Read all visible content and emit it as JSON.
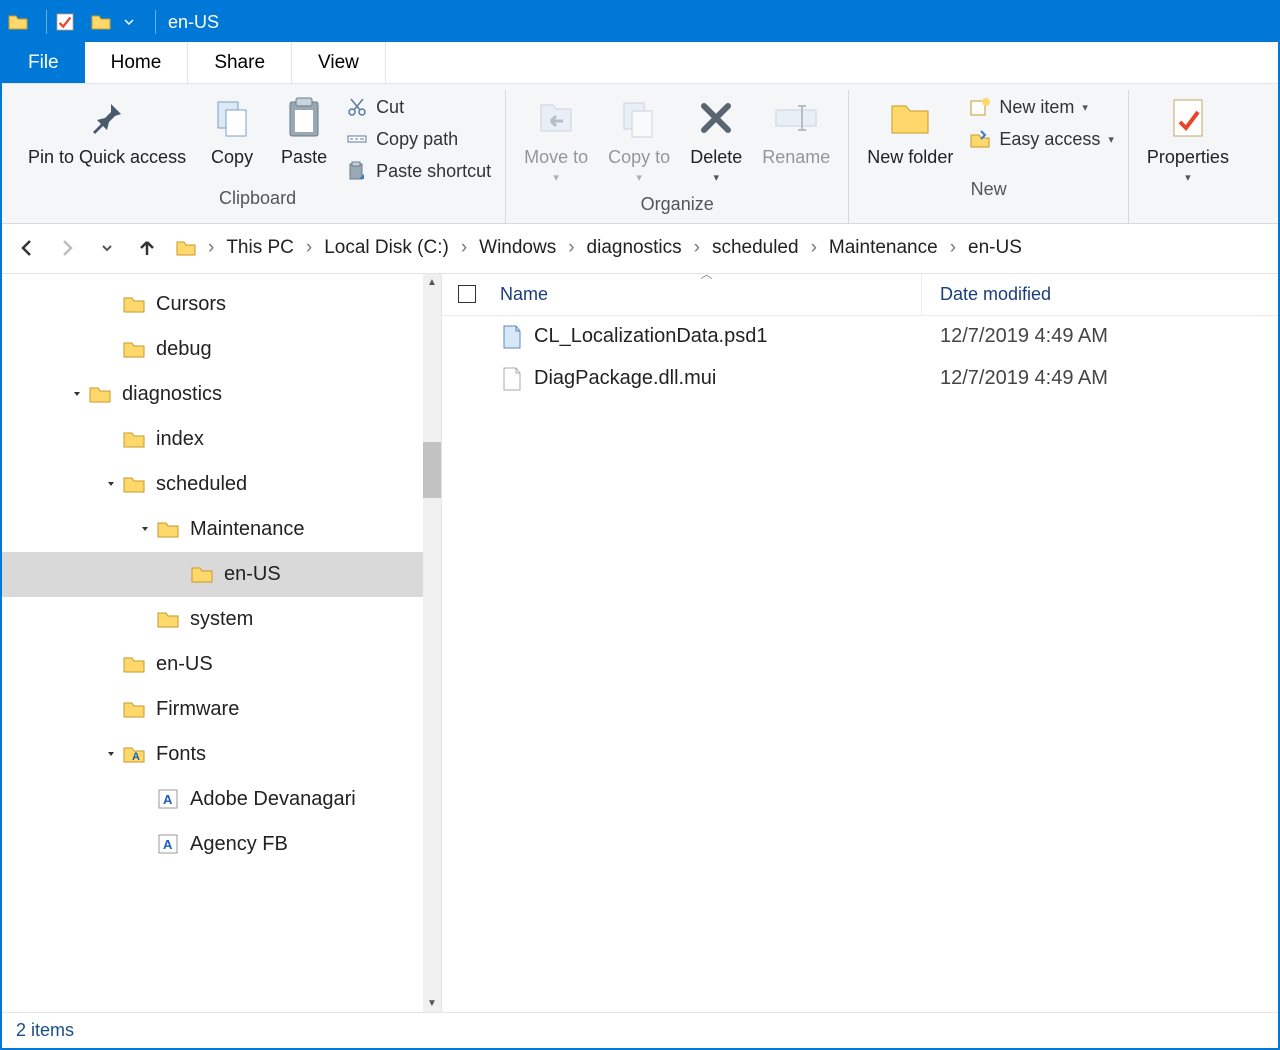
{
  "window": {
    "title": "en-US"
  },
  "tabs": {
    "file": "File",
    "home": "Home",
    "share": "Share",
    "view": "View"
  },
  "ribbon": {
    "clipboard": {
      "label": "Clipboard",
      "pin": "Pin to Quick access",
      "copy": "Copy",
      "paste": "Paste",
      "cut": "Cut",
      "copy_path": "Copy path",
      "paste_shortcut": "Paste shortcut"
    },
    "organize": {
      "label": "Organize",
      "move_to": "Move to",
      "copy_to": "Copy to",
      "delete": "Delete",
      "rename": "Rename"
    },
    "new": {
      "label": "New",
      "new_folder": "New folder",
      "new_item": "New item",
      "easy_access": "Easy access"
    },
    "properties": "Properties"
  },
  "breadcrumbs": [
    "This PC",
    "Local Disk (C:)",
    "Windows",
    "diagnostics",
    "scheduled",
    "Maintenance",
    "en-US"
  ],
  "tree": [
    {
      "indent": 2,
      "chev": "",
      "icon": "folder",
      "label": "Cursors",
      "sel": false
    },
    {
      "indent": 2,
      "chev": "",
      "icon": "folder",
      "label": "debug",
      "sel": false
    },
    {
      "indent": 1,
      "chev": "v",
      "icon": "folder",
      "label": "diagnostics",
      "sel": false
    },
    {
      "indent": 2,
      "chev": "",
      "icon": "folder",
      "label": "index",
      "sel": false
    },
    {
      "indent": 2,
      "chev": "v",
      "icon": "folder",
      "label": "scheduled",
      "sel": false
    },
    {
      "indent": 3,
      "chev": "v",
      "icon": "folder",
      "label": "Maintenance",
      "sel": false
    },
    {
      "indent": 4,
      "chev": "",
      "icon": "folder",
      "label": "en-US",
      "sel": true
    },
    {
      "indent": 3,
      "chev": "",
      "icon": "folder",
      "label": "system",
      "sel": false
    },
    {
      "indent": 2,
      "chev": "",
      "icon": "folder",
      "label": "en-US",
      "sel": false
    },
    {
      "indent": 2,
      "chev": "",
      "icon": "folder",
      "label": "Firmware",
      "sel": false
    },
    {
      "indent": 2,
      "chev": "v",
      "icon": "fonts",
      "label": "Fonts",
      "sel": false
    },
    {
      "indent": 3,
      "chev": "",
      "icon": "font",
      "label": "Adobe Devanagari",
      "sel": false
    },
    {
      "indent": 3,
      "chev": "",
      "icon": "font",
      "label": "Agency FB",
      "sel": false
    }
  ],
  "columns": {
    "name": "Name",
    "date": "Date modified"
  },
  "files": [
    {
      "icon": "psd1",
      "name": "CL_LocalizationData.psd1",
      "date": "12/7/2019 4:49 AM"
    },
    {
      "icon": "mui",
      "name": "DiagPackage.dll.mui",
      "date": "12/7/2019 4:49 AM"
    }
  ],
  "status": "2 items"
}
